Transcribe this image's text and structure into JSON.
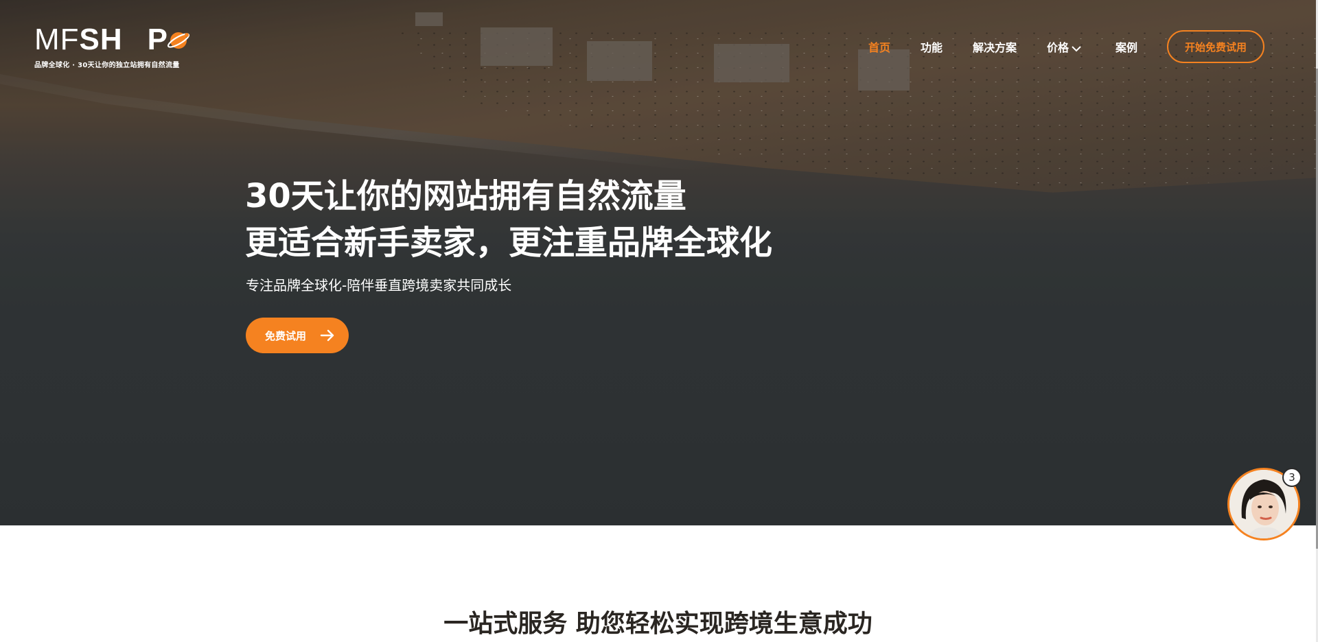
{
  "logo": {
    "prefix": "MF",
    "mid": "SH",
    "suffix": "P",
    "tagline": "品牌全球化 · 30天让你的独立站拥有自然流量"
  },
  "nav": {
    "items": [
      {
        "label": "首页",
        "active": true
      },
      {
        "label": "功能"
      },
      {
        "label": "解决方案"
      },
      {
        "label": "价格",
        "has_dropdown": true
      },
      {
        "label": "案例"
      }
    ],
    "cta": "开始免费试用"
  },
  "hero": {
    "title_line1": "30天让你的网站拥有自然流量",
    "title_line2": "更适合新手卖家，更注重品牌全球化",
    "subtitle": "专注品牌全球化-陪伴垂直跨境卖家共同成长",
    "button": "免费试用"
  },
  "chat": {
    "badge_count": "3"
  },
  "section": {
    "title": "一站式服务 助您轻松实现跨境生意成功"
  },
  "colors": {
    "accent": "#f58220",
    "hero_overlay": "#33383a",
    "text_dark": "#2a2622"
  }
}
